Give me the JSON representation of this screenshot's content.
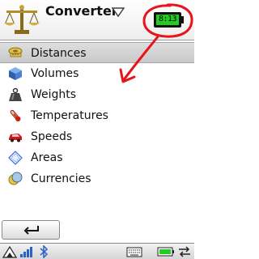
{
  "app": {
    "title": "Converter",
    "battery_time": "8:13"
  },
  "menu": {
    "items": [
      {
        "label": "Distances",
        "icon": "distance-tape-icon",
        "selected": true
      },
      {
        "label": "Volumes",
        "icon": "cube-icon",
        "selected": false
      },
      {
        "label": "Weights",
        "icon": "weight-icon",
        "selected": false
      },
      {
        "label": "Temperatures",
        "icon": "thermometer-icon",
        "selected": false
      },
      {
        "label": "Speeds",
        "icon": "car-icon",
        "selected": false
      },
      {
        "label": "Areas",
        "icon": "area-icon",
        "selected": false
      },
      {
        "label": "Currencies",
        "icon": "coins-icon",
        "selected": false
      }
    ]
  },
  "toolbar": {
    "back_icon": "back-arrow-icon"
  },
  "statusbar": {
    "icons": [
      "home-icon",
      "signal-icon",
      "bluetooth-icon",
      "keyboard-icon",
      "battery-icon",
      "connectivity-icon"
    ]
  },
  "colors": {
    "annotation_red": "#e8141c",
    "selection_gray": "#d0d0d0"
  }
}
